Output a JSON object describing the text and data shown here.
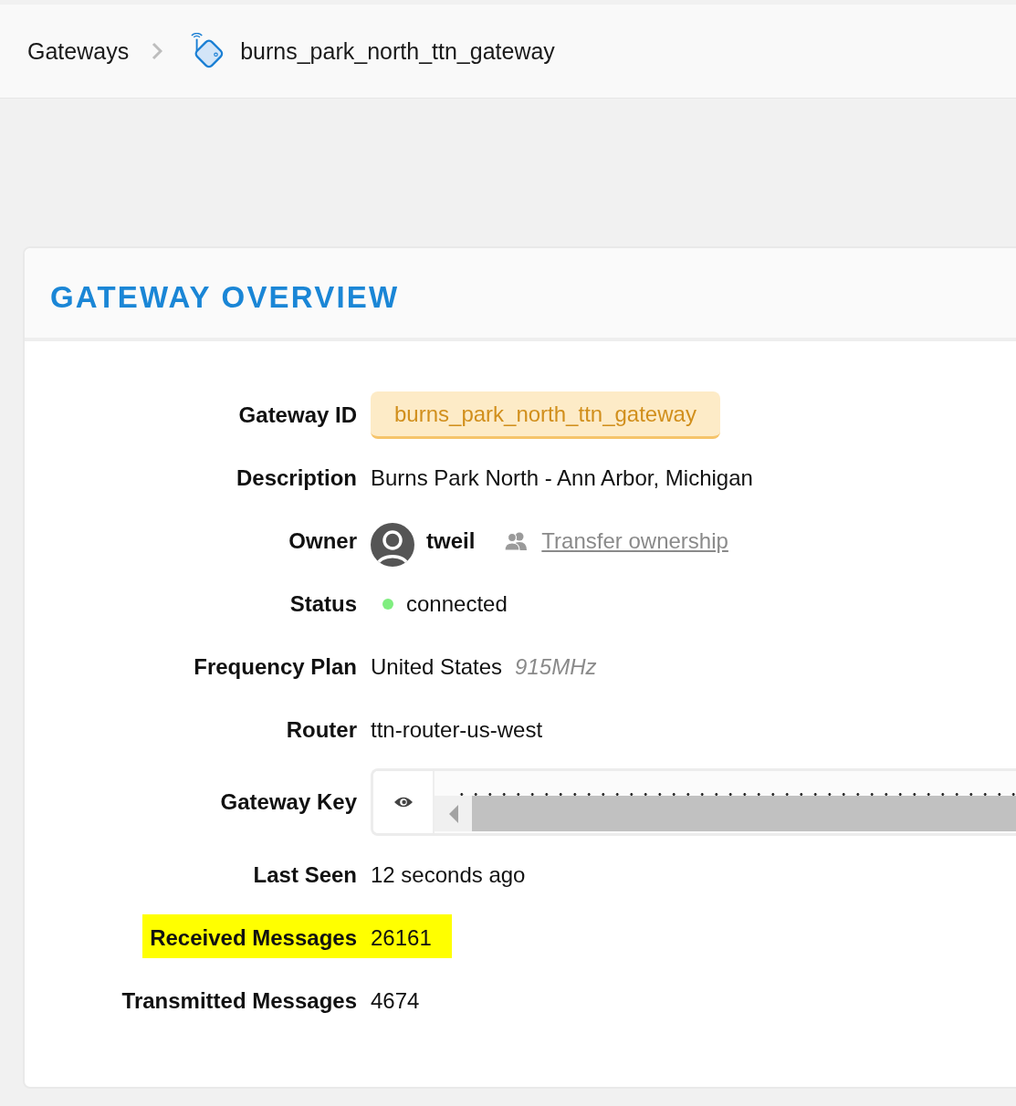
{
  "breadcrumb": [
    {
      "label": "Gateways",
      "kind": "link"
    },
    {
      "label": "burns_park_north_ttn_gateway",
      "kind": "gateway"
    }
  ],
  "card": {
    "title": "GATEWAY OVERVIEW"
  },
  "fields": [
    {
      "kind": "badge",
      "label": "Gateway ID",
      "value": "burns_park_north_ttn_gateway",
      "highlighted": false
    },
    {
      "kind": "text",
      "label": "Description",
      "value": "Burns Park North - Ann Arbor, Michigan",
      "highlighted": false
    },
    {
      "kind": "owner",
      "label": "Owner",
      "user": "tweil",
      "action": "Transfer ownership",
      "highlighted": false
    },
    {
      "kind": "status",
      "label": "Status",
      "value": "connected",
      "color": "#80ee80",
      "highlighted": false
    },
    {
      "kind": "frequency",
      "label": "Frequency Plan",
      "value": "United States",
      "note": "915MHz",
      "highlighted": false
    },
    {
      "kind": "text",
      "label": "Router",
      "value": "ttn-router-us-west",
      "highlighted": false
    },
    {
      "kind": "key",
      "label": "Gateway Key",
      "highlighted": false
    },
    {
      "kind": "text",
      "label": "Last Seen",
      "value": "12 seconds ago",
      "highlighted": false
    },
    {
      "kind": "text",
      "label": "Received Messages",
      "value": "26161",
      "highlighted": true
    },
    {
      "kind": "text",
      "label": "Transmitted Messages",
      "value": "4674",
      "highlighted": false
    }
  ]
}
